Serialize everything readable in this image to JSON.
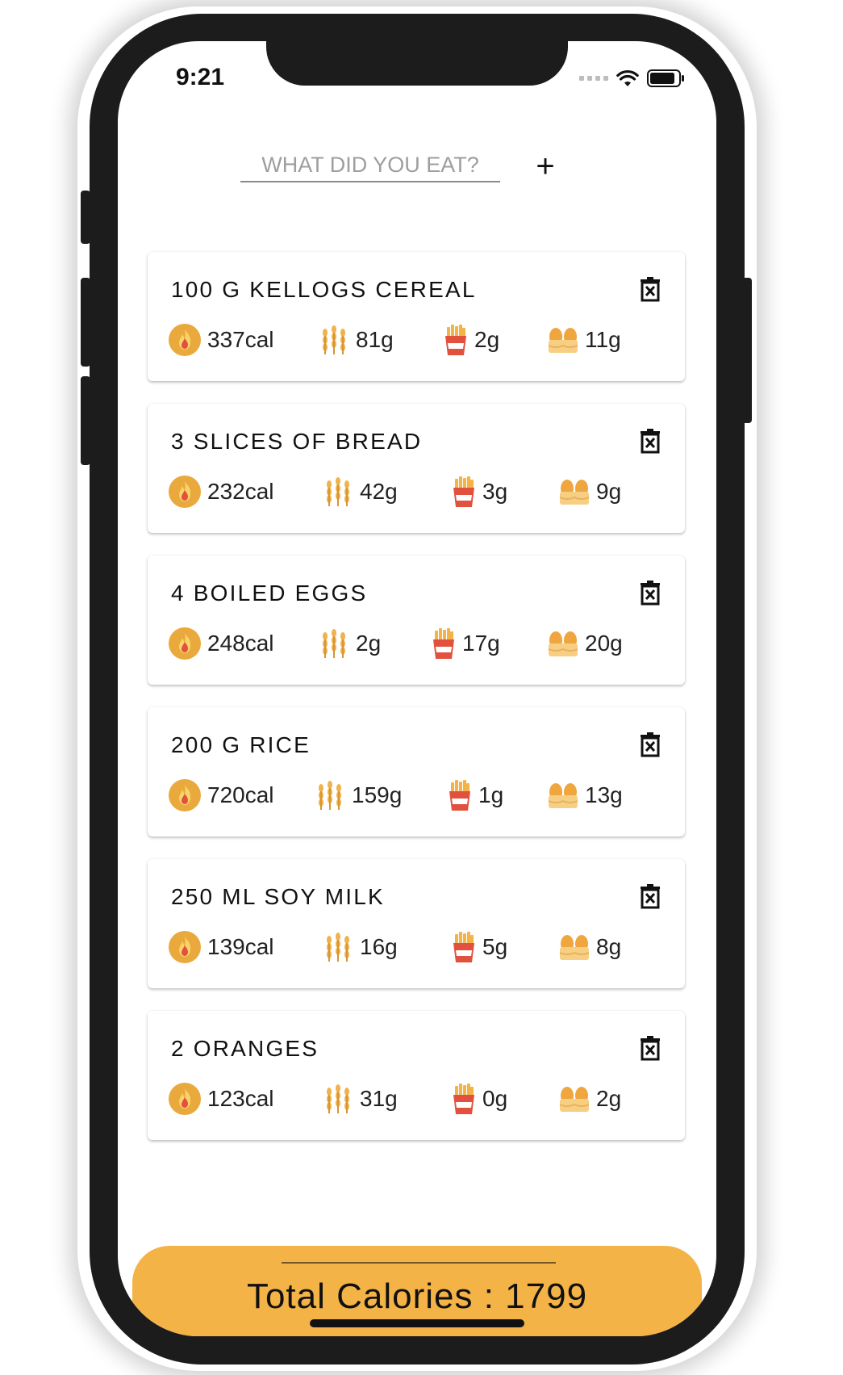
{
  "status_bar": {
    "time": "9:21"
  },
  "input": {
    "placeholder": "WHAT DID YOU EAT?",
    "add_label": "+"
  },
  "foods": [
    {
      "name": "100 G KELLOGS CEREAL",
      "calories": "337cal",
      "carbs": "81g",
      "fat": "2g",
      "protein": "11g"
    },
    {
      "name": "3 SLICES OF BREAD",
      "calories": "232cal",
      "carbs": "42g",
      "fat": "3g",
      "protein": "9g"
    },
    {
      "name": "4 BOILED EGGS",
      "calories": "248cal",
      "carbs": "2g",
      "fat": "17g",
      "protein": "20g"
    },
    {
      "name": "200 G RICE",
      "calories": "720cal",
      "carbs": "159g",
      "fat": "1g",
      "protein": "13g"
    },
    {
      "name": "250 ML SOY MILK",
      "calories": "139cal",
      "carbs": "16g",
      "fat": "5g",
      "protein": "8g"
    },
    {
      "name": "2 ORANGES",
      "calories": "123cal",
      "carbs": "31g",
      "fat": "0g",
      "protein": "2g"
    }
  ],
  "icons": {
    "calories": "flame-icon",
    "carbs": "wheat-icon",
    "fat": "fries-icon",
    "protein": "eggs-icon",
    "delete": "trash-icon"
  },
  "colors": {
    "accent": "#f4b347",
    "flame": "#e9a93c",
    "fries_red": "#e2513d"
  },
  "total": {
    "text": "Total Calories : 1799"
  }
}
